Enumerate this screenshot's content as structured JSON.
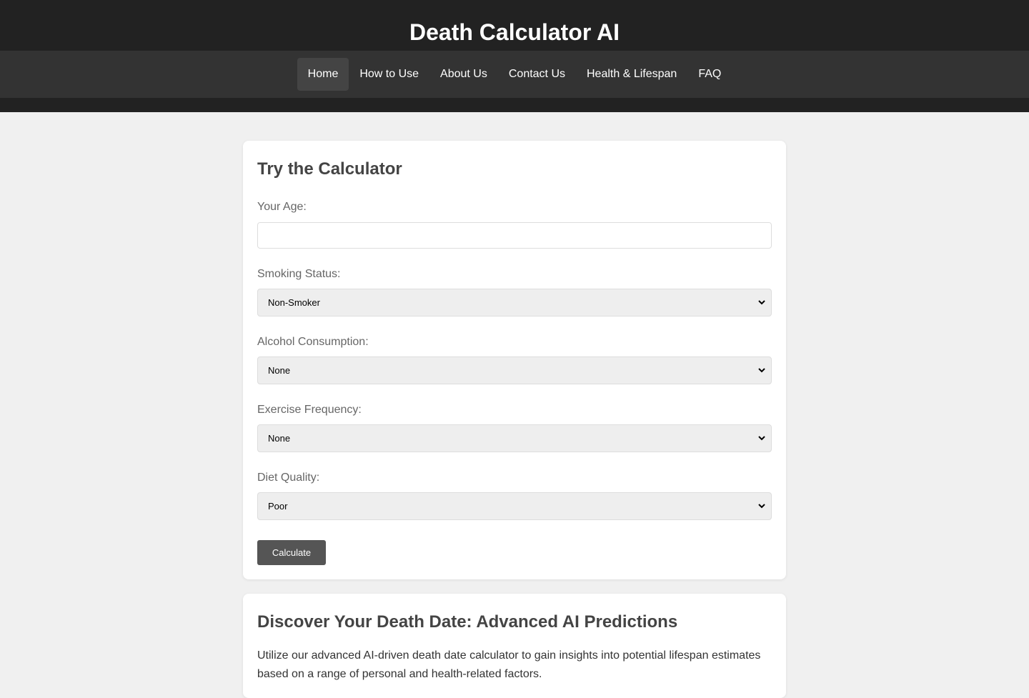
{
  "header": {
    "title": "Death Calculator AI"
  },
  "nav": [
    {
      "label": "Home",
      "active": true
    },
    {
      "label": "How to Use"
    },
    {
      "label": "About Us"
    },
    {
      "label": "Contact Us"
    },
    {
      "label": "Health & Lifespan"
    },
    {
      "label": "FAQ"
    }
  ],
  "calculator": {
    "title": "Try the Calculator",
    "age_label": "Your Age:",
    "age_value": "",
    "smoking_label": "Smoking Status:",
    "smoking_value": "Non-Smoker",
    "alcohol_label": "Alcohol Consumption:",
    "alcohol_value": "None",
    "exercise_label": "Exercise Frequency:",
    "exercise_value": "None",
    "diet_label": "Diet Quality:",
    "diet_value": "Poor",
    "button": "Calculate"
  },
  "info": {
    "title": "Discover Your Death Date: Advanced AI Predictions",
    "text": "Utilize our advanced AI-driven death date calculator to gain insights into potential lifespan estimates based on a range of personal and health-related factors."
  }
}
